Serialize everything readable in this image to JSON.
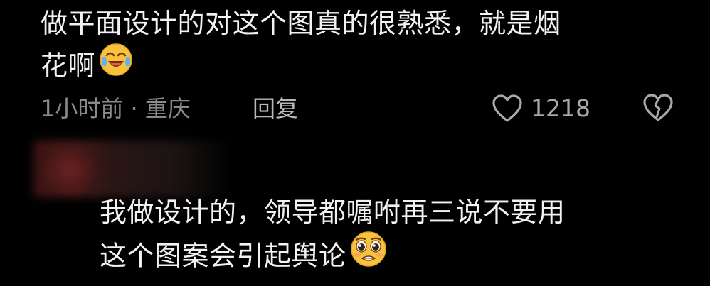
{
  "comment": {
    "line1": "做平面设计的对这个图真的很熟悉，就是烟",
    "line2": "花啊",
    "emoji": "crying-laughing-emoji",
    "time_location": "1小时前 · 重庆",
    "reply_label": "回复",
    "like_count": "1218",
    "icons": {
      "like": "heart-outline-icon",
      "dislike": "broken-heart-icon"
    }
  },
  "reply": {
    "line1": "我做设计的，领导都嘱咐再三说不要用",
    "line2": "这个图案会引起舆论",
    "emoji": "pleading-face-emoji"
  },
  "colors": {
    "background": "#000000",
    "text": "#f2f2f2",
    "meta": "#8a8a8a",
    "emoji_yellow": "#f9c23c"
  }
}
